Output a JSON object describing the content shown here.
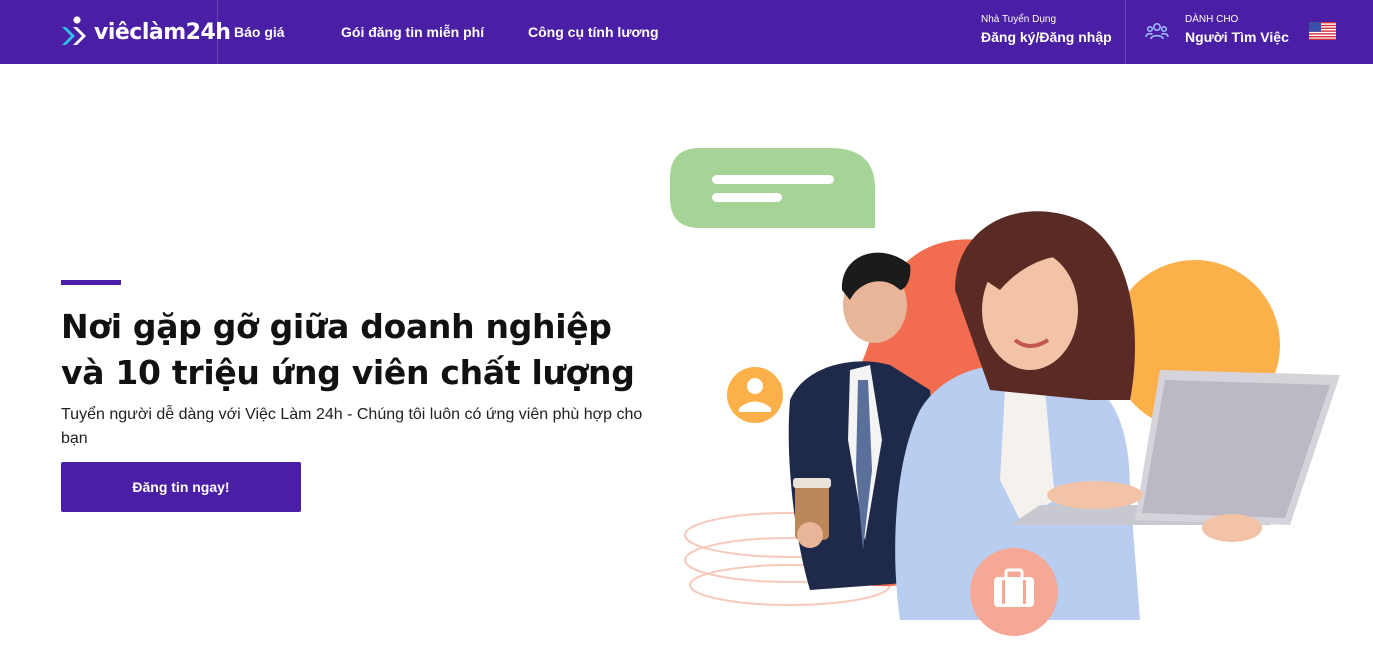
{
  "header": {
    "logo_text": "viêclàm24h",
    "nav": [
      {
        "label": "Báo giá"
      },
      {
        "label": "Gói đăng tin miễn phí"
      },
      {
        "label": "Công cụ tính lương"
      }
    ],
    "employer": {
      "small": "Nhà Tuyển Dụng",
      "big": "Đăng ký/Đăng nhập"
    },
    "seeker": {
      "small": "DÀNH CHO",
      "big": "Người Tìm Việc",
      "icon": "users-icon"
    },
    "language_flag": "us-flag-icon"
  },
  "hero": {
    "headline_line1": "Nơi gặp gỡ giữa doanh nghiệp",
    "headline_line2_prefix": "và 10 triệu ứng viên ",
    "headline_highlight": "chất lượng",
    "subtitle": "Tuyển người dễ dàng với Việc Làm 24h - Chúng tôi luôn có ứng viên phù hợp cho bạn",
    "cta_label": "Đăng tin ngay!"
  },
  "colors": {
    "brand": "#4a1fa6",
    "highlight": "#2fc2e6",
    "bubble_green": "#a6d396",
    "blob_orange": "#f26d4f",
    "blob_yellow": "#fbb04a",
    "badge_pink": "#f6a896"
  }
}
